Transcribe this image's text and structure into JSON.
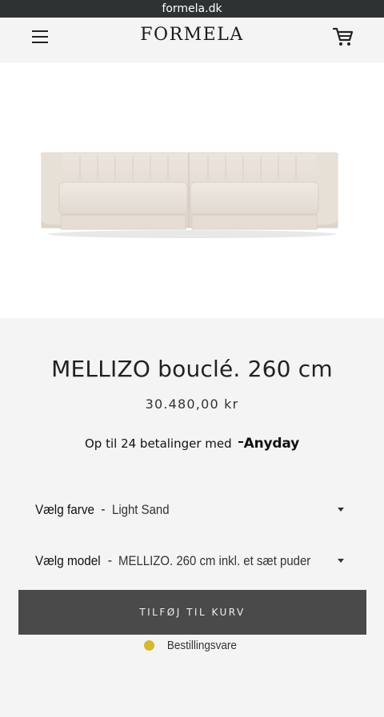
{
  "browser": {
    "url": "formela.dk"
  },
  "header": {
    "logo": "FORMELA",
    "menu_icon": "hamburger-menu-icon",
    "cart_icon": "shopping-cart-icon"
  },
  "product": {
    "image": "sofa-product-image",
    "title": "MELLIZO bouclé. 260 cm",
    "price": "30.480,00 kr"
  },
  "financing": {
    "text": "Op til 24 betalinger med",
    "provider": "Anyday"
  },
  "options": {
    "color": {
      "label": "Vælg farve",
      "separator": "-",
      "value": "Light Sand"
    },
    "model": {
      "label": "Vælg model",
      "separator": "-",
      "value": "MELLIZO. 260 cm inkl. et sæt puder"
    }
  },
  "cart": {
    "add_label": "TILFØJ TIL KURV"
  },
  "availability": {
    "text": "Bestillingsvare",
    "status_color": "#d4b82e"
  },
  "colors": {
    "urlbar": "#2d3233",
    "button": "#4a4a4a",
    "background": "#f4f4f4"
  }
}
